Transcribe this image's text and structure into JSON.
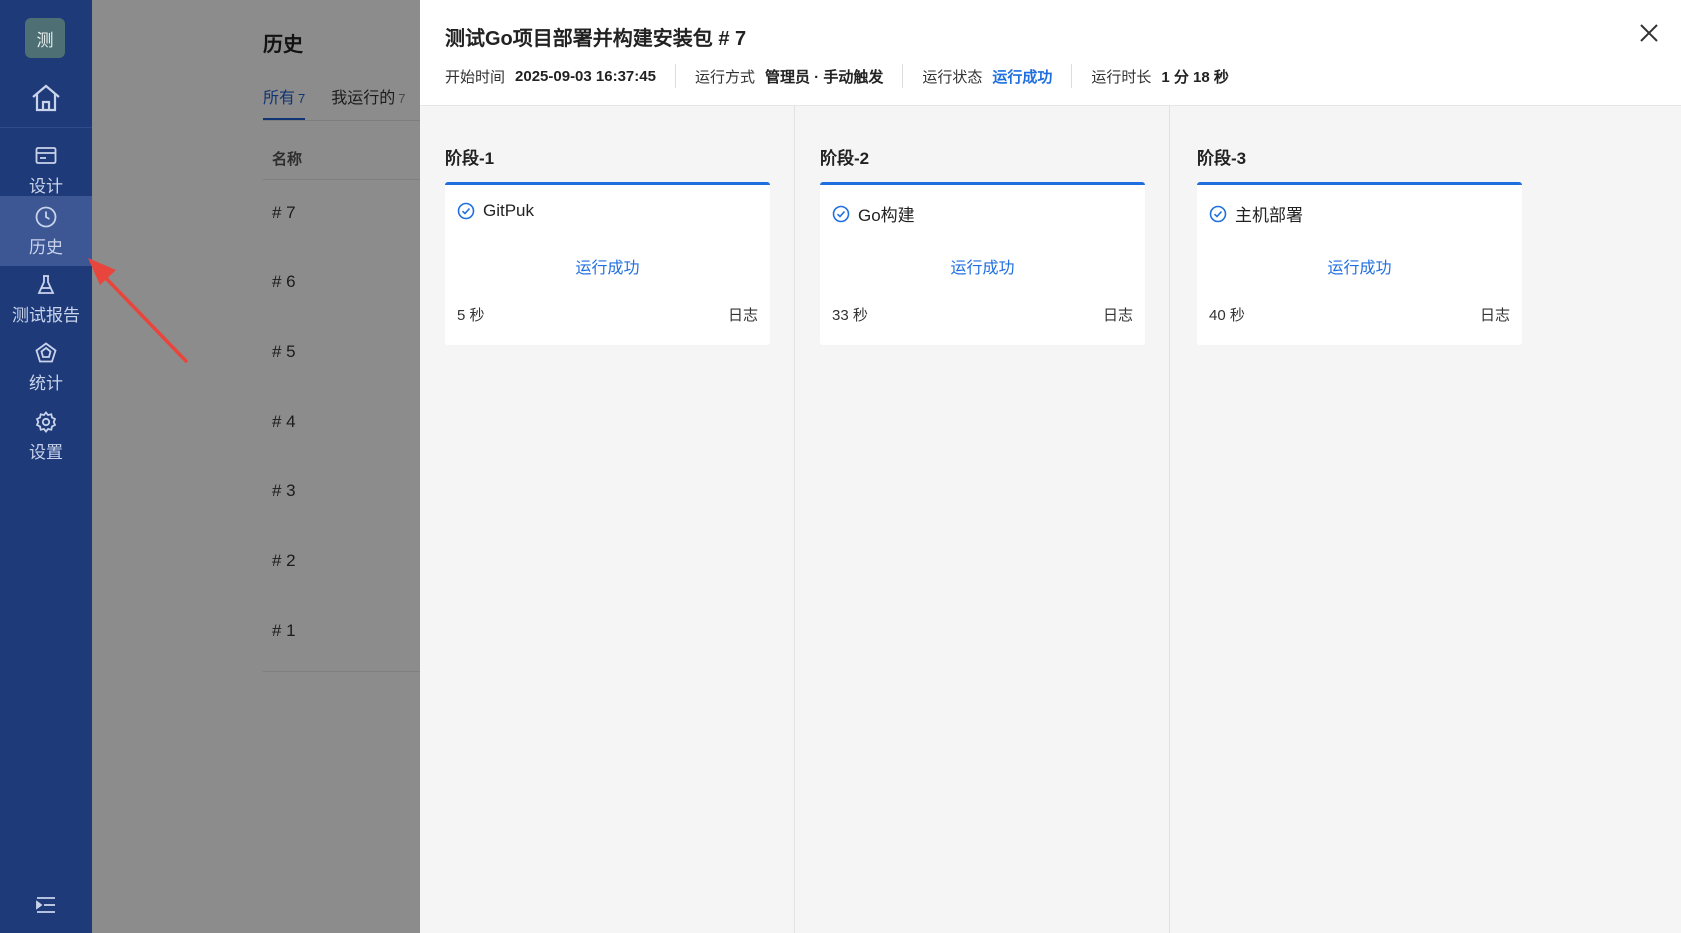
{
  "sidebar": {
    "logo_text": "测",
    "items": [
      {
        "label": "设计"
      },
      {
        "label": "历史"
      },
      {
        "label": "测试报告"
      },
      {
        "label": "统计"
      },
      {
        "label": "设置"
      }
    ]
  },
  "history_page": {
    "title": "历史",
    "tabs": [
      {
        "label": "所有",
        "count": "7"
      },
      {
        "label": "我运行的",
        "count": "7"
      }
    ],
    "column_name": "名称",
    "rows": [
      "# 7",
      "# 6",
      "# 5",
      "# 4",
      "# 3",
      "# 2",
      "# 1"
    ]
  },
  "drawer": {
    "title": "测试Go项目部署并构建安装包 # 7",
    "meta": {
      "start_label": "开始时间",
      "start_value": "2025-09-03 16:37:45",
      "mode_label": "运行方式",
      "mode_value": "管理员 · 手动触发",
      "status_label": "运行状态",
      "status_value": "运行成功",
      "duration_label": "运行时长",
      "duration_value": "1 分 18 秒"
    },
    "stages": [
      {
        "name": "阶段-1",
        "task": "GitPuk",
        "status": "运行成功",
        "duration": "5 秒",
        "log": "日志"
      },
      {
        "name": "阶段-2",
        "task": "Go构建",
        "status": "运行成功",
        "duration": "33 秒",
        "log": "日志"
      },
      {
        "name": "阶段-3",
        "task": "主机部署",
        "status": "运行成功",
        "duration": "40 秒",
        "log": "日志"
      }
    ]
  },
  "colors": {
    "sidebar_bg": "#1f3a78",
    "accent": "#1f6fe0",
    "annotation_arrow": "#e8453c"
  },
  "icons": [
    "home-icon",
    "design-icon",
    "clock-icon",
    "flask-icon",
    "pentagon-icon",
    "gear-icon",
    "menu-collapse-icon",
    "close-icon",
    "check-circle-icon",
    "arrow-annotation"
  ]
}
